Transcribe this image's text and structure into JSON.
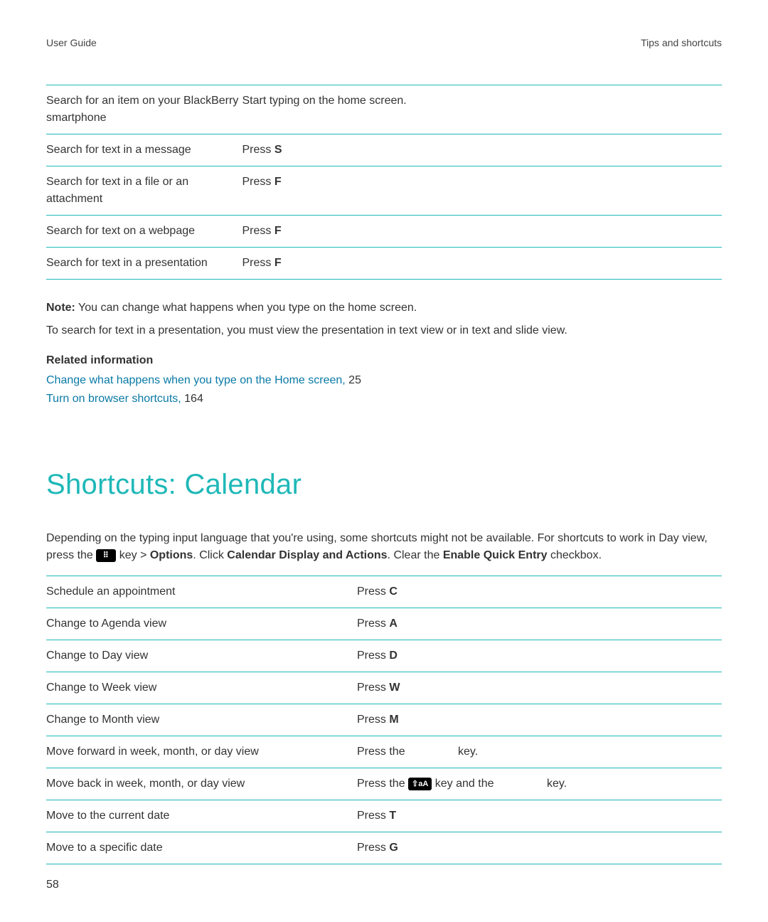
{
  "header": {
    "left": "User Guide",
    "right": "Tips and shortcuts"
  },
  "table1": {
    "rows": [
      {
        "action": "Search for an item on your BlackBerry smartphone",
        "instruction": "Start typing on the home screen.",
        "key": ""
      },
      {
        "action": "Search for text in a message",
        "instruction": "Press ",
        "key": "S"
      },
      {
        "action": "Search for text in a file or an attachment",
        "instruction": "Press ",
        "key": "F"
      },
      {
        "action": "Search for text on a webpage",
        "instruction": "Press ",
        "key": "F"
      },
      {
        "action": "Search for text in a presentation",
        "instruction": "Press ",
        "key": "F"
      }
    ]
  },
  "note": {
    "label": "Note:",
    "text": " You can change what happens when you type on the home screen.",
    "para2": "To search for text in a presentation, you must view the presentation in text view or in text and slide view."
  },
  "related": {
    "heading": "Related information",
    "links": [
      {
        "text": "Change what happens when you type on the Home screen,",
        "page": " 25"
      },
      {
        "text": "Turn on browser shortcuts,",
        "page": " 164"
      }
    ]
  },
  "section": {
    "title": "Shortcuts: Calendar",
    "intro_a": "Depending on the typing input language that you're using, some shortcuts might not be available. For shortcuts to work in ",
    "intro_b": "Day view, press the ",
    "intro_key_glyph": "⠿",
    "intro_c": " key > ",
    "intro_options": "Options",
    "intro_d": ". Click ",
    "intro_cda": "Calendar Display and Actions",
    "intro_e": ". Clear the ",
    "intro_eqe": "Enable Quick Entry",
    "intro_f": " checkbox."
  },
  "table2": {
    "rows": [
      {
        "action": "Schedule an appointment",
        "prefix": "Press ",
        "key": "C",
        "suffix": ""
      },
      {
        "action": "Change to Agenda view",
        "prefix": "Press ",
        "key": "A",
        "suffix": ""
      },
      {
        "action": "Change to Day view",
        "prefix": "Press ",
        "key": "D",
        "suffix": ""
      },
      {
        "action": "Change to Week view",
        "prefix": "Press ",
        "key": "W",
        "suffix": ""
      },
      {
        "action": "Change to Month view",
        "prefix": "Press ",
        "key": "M",
        "suffix": ""
      },
      {
        "action": "Move forward in week, month, or day view",
        "prefix": "Press the ",
        "key": "",
        "suffix": "key.",
        "gap": true
      },
      {
        "action": "Move back in week, month, or day view",
        "prefix": "Press the ",
        "shift_glyph": "⇧aA",
        "mid": " key and the ",
        "suffix": "key.",
        "gap2": true
      },
      {
        "action": "Move to the current date",
        "prefix": "Press ",
        "key": "T",
        "suffix": ""
      },
      {
        "action": "Move to a specific date",
        "prefix": "Press ",
        "key": "G",
        "suffix": ""
      }
    ]
  },
  "page_number": "58"
}
